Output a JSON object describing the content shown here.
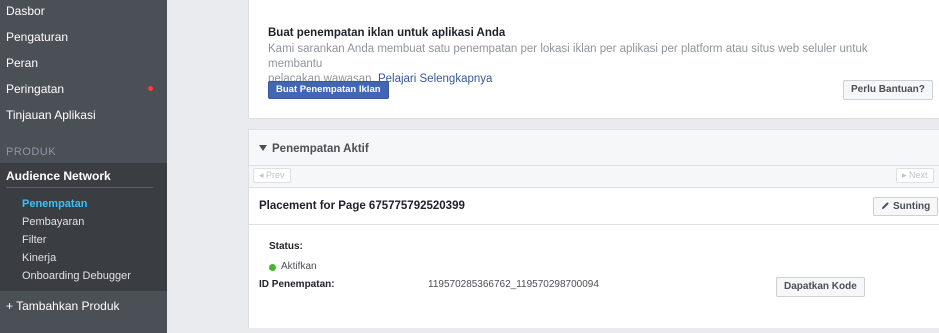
{
  "sidebar": {
    "items": [
      {
        "label": "Dasbor"
      },
      {
        "label": "Pengaturan"
      },
      {
        "label": "Peran"
      },
      {
        "label": "Peringatan"
      },
      {
        "label": "Tinjauan Aplikasi"
      }
    ],
    "alert_dot_color": "#fa3e3e",
    "section_label": "PRODUK",
    "audience_network": {
      "label": "Audience Network",
      "sub_items": [
        {
          "label": "Penempatan",
          "active": true
        },
        {
          "label": "Pembayaran"
        },
        {
          "label": "Filter"
        },
        {
          "label": "Kinerja"
        },
        {
          "label": "Onboarding Debugger"
        }
      ]
    },
    "add_product": "+ Tambahkan Produk"
  },
  "create_card": {
    "title": "Buat penempatan iklan untuk aplikasi Anda",
    "description_line1": "Kami sarankan Anda membuat satu penempatan per lokasi iklan per aplikasi per platform atau situs web seluler untuk membantu",
    "description_line2": "pelacakan wawasan.",
    "learn_more": "Pelajari Selengkapnya",
    "create_button": "Buat Penempatan Iklan",
    "help_button": "Perlu Bantuan?"
  },
  "active_card": {
    "title": "Penempatan Aktif",
    "prev": "◂ Prev",
    "next": "▸ Next",
    "placement": {
      "title": "Placement for Page 675775792520399",
      "edit_button": "Sunting",
      "status_label": "Status:",
      "status_value": "Aktifkan",
      "status_color": "#42b72a",
      "id_label": "ID Penempatan:",
      "id_value": "119570285366762_119570298700094",
      "get_code_button": "Dapatkan Kode"
    }
  },
  "colors": {
    "sidebar_bg": "#4b4f56",
    "active_sub_item": "#39c0f7",
    "primary_button": "#4267b2",
    "link": "#365899"
  }
}
